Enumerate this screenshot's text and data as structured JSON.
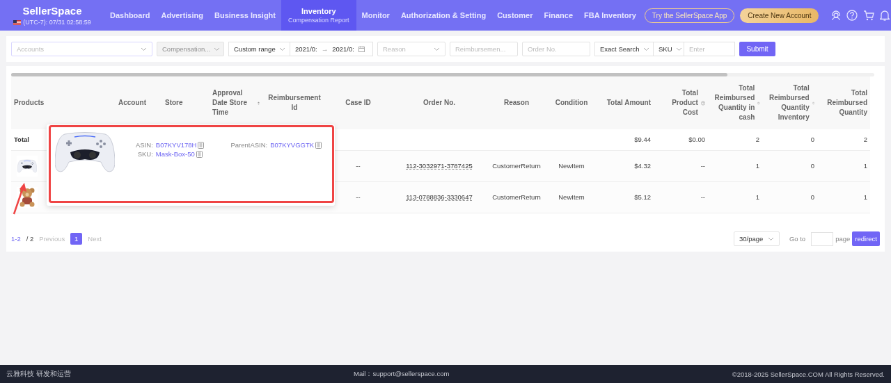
{
  "brand": {
    "name": "SellerSpace",
    "clock": "(UTC-7): 07/31 02:58:59"
  },
  "nav": [
    {
      "label": "Dashboard",
      "selected": false
    },
    {
      "label": "Advertising",
      "selected": false
    },
    {
      "label": "Business Insight",
      "selected": false
    },
    {
      "label": "Inventory",
      "subtitle": "Compensation Report",
      "selected": true
    },
    {
      "label": "Monitor",
      "selected": false
    },
    {
      "label": "Authorization & Setting",
      "selected": false
    },
    {
      "label": "Customer",
      "selected": false
    },
    {
      "label": "Finance",
      "selected": false
    },
    {
      "label": "FBA Inventory",
      "selected": false
    }
  ],
  "header_buttons": [
    "Try the SellerSpace App",
    "Create New Account"
  ],
  "filters": {
    "accounts": {
      "placeholder": "Accounts"
    },
    "compensation": {
      "placeholder": "Compensation...",
      "disabled": true
    },
    "range": "Custom range",
    "date_from": "2021/0:",
    "date_separator": "→",
    "date_to": "2021/0:",
    "reason": {
      "placeholder": "Reason"
    },
    "reimbursement": {
      "placeholder": "Reimbursemen..."
    },
    "order_no": {
      "placeholder": "Order No."
    },
    "search_mode": "Exact Search",
    "search_field": "SKU",
    "search_value": {
      "placeholder": "Enter"
    },
    "submit": "Submit"
  },
  "table": {
    "columns": [
      {
        "label": "Products"
      },
      {
        "label": "Account"
      },
      {
        "label": "Store"
      },
      {
        "label": "Approval Date Store Time",
        "sortable": true
      },
      {
        "label": "Reimbursement Id"
      },
      {
        "label": "Case ID"
      },
      {
        "label": "Order No."
      },
      {
        "label": "Reason"
      },
      {
        "label": "Condition"
      },
      {
        "label": "Total Amount"
      },
      {
        "label": "Total Product Cost",
        "help": true
      },
      {
        "label": "Total Reimbursed Quantity in cash",
        "help": true
      },
      {
        "label": "Total Reimbursed Quantity Inventory",
        "help": true
      },
      {
        "label": "Total Reimbursed Quantity"
      }
    ],
    "rows": [
      {
        "kind": "total",
        "label": "Total",
        "total_amount": "$9.44",
        "total_product_cost": "$0.00",
        "qty_cash": "2",
        "qty_inventory": "0",
        "qty_total": "2"
      },
      {
        "kind": "item",
        "product": {
          "kind": "controller"
        },
        "case_id": "--",
        "order_no": "112-3032971-3787425",
        "reason": "CustomerReturn",
        "condition": "NewItem",
        "total_amount": "$4.32",
        "total_product_cost": "--",
        "qty_cash": "1",
        "qty_inventory": "0",
        "qty_total": "1"
      },
      {
        "kind": "item",
        "product": {
          "kind": "teddy"
        },
        "case_id": "--",
        "order_no": "113-0788836-3330647",
        "reason": "CustomerReturn",
        "condition": "NewItem",
        "total_amount": "$5.12",
        "total_product_cost": "--",
        "qty_cash": "1",
        "qty_inventory": "0",
        "qty_total": "1"
      }
    ]
  },
  "popup": {
    "image": {
      "kind": "controller"
    },
    "asin_label": "ASIN:",
    "asin": "B07KYV178H",
    "sku_label": "SKU:",
    "sku": "Mask-Box-50",
    "parent_label": "ParentASIN:",
    "parent_asin": "B07KYVGGTK"
  },
  "pagination": {
    "range": "1-2",
    "total": "/ 2",
    "previous": "Previous",
    "pages": [
      {
        "label": "1",
        "selected": true
      }
    ],
    "next": "Next",
    "page_size": "30/page",
    "goto": "Go to",
    "page_word": "page",
    "redirect": "redirect"
  },
  "footer": {
    "left": "云雅科技 研发和运营",
    "mail": "Mail：support@sellerspace.com",
    "copyright": "©2018-2025 SellerSpace.COM All Rights Reserved."
  }
}
